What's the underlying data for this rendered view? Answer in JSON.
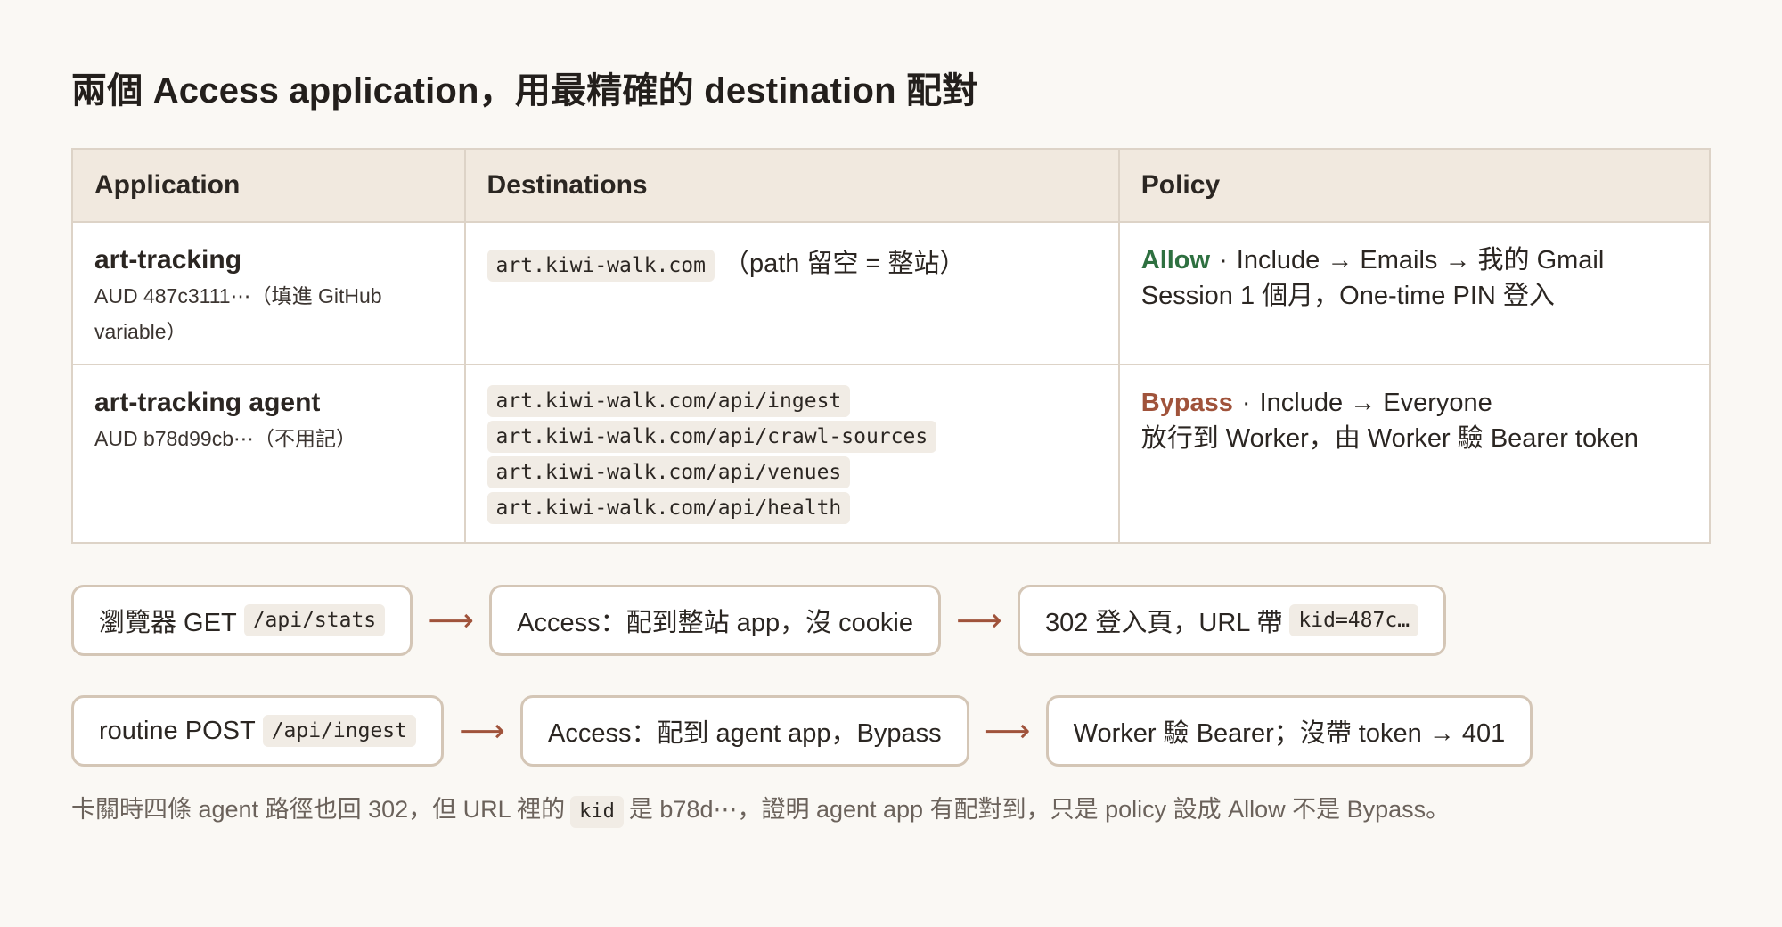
{
  "title": "兩個 Access application，用最精確的 destination 配對",
  "table": {
    "headers": [
      "Application",
      "Destinations",
      "Policy"
    ],
    "rows": [
      {
        "name": "art-tracking",
        "sub": "AUD 487c3111⋯（填進 GitHub variable）",
        "destinations": [
          "art.kiwi-walk.com"
        ],
        "dest_note": "（path 留空 = 整站）",
        "policy_action": "Allow",
        "policy_rule": "Include → Emails → 我的 Gmail",
        "policy_detail": "Session 1 個月，One-time PIN 登入"
      },
      {
        "name": "art-tracking agent",
        "sub": "AUD b78d99cb⋯（不用記）",
        "destinations": [
          "art.kiwi-walk.com/api/ingest",
          "art.kiwi-walk.com/api/crawl-sources",
          "art.kiwi-walk.com/api/venues",
          "art.kiwi-walk.com/api/health"
        ],
        "dest_note": "",
        "policy_action": "Bypass",
        "policy_rule": "Include → Everyone",
        "policy_detail": "放行到 Worker，由 Worker 驗 Bearer token"
      }
    ]
  },
  "flows": [
    {
      "step1_text": "瀏覽器 GET",
      "step1_code": "/api/stats",
      "step2_text": "Access：配到整站 app，沒 cookie",
      "step3_text": "302 登入頁，URL 帶",
      "step3_code": "kid=487c…"
    },
    {
      "step1_text": "routine POST",
      "step1_code": "/api/ingest",
      "step2_text": "Access：配到 agent app，Bypass",
      "step3_text": "Worker 驗 Bearer；沒帶 token → 401",
      "step3_code": ""
    }
  ],
  "arrow_glyph": "⟶",
  "footnote": {
    "before": "卡關時四條 agent 路徑也回 302，但 URL 裡的",
    "code": "kid",
    "after": "是 b78d⋯，證明 agent app 有配對到，只是 policy 設成 Allow 不是 Bypass。"
  },
  "colors": {
    "allow": "#2e7040",
    "bypass": "#a0533b",
    "arrow": "#a0533b",
    "header_bg": "#f1e9df",
    "border": "#ddd3c7"
  }
}
